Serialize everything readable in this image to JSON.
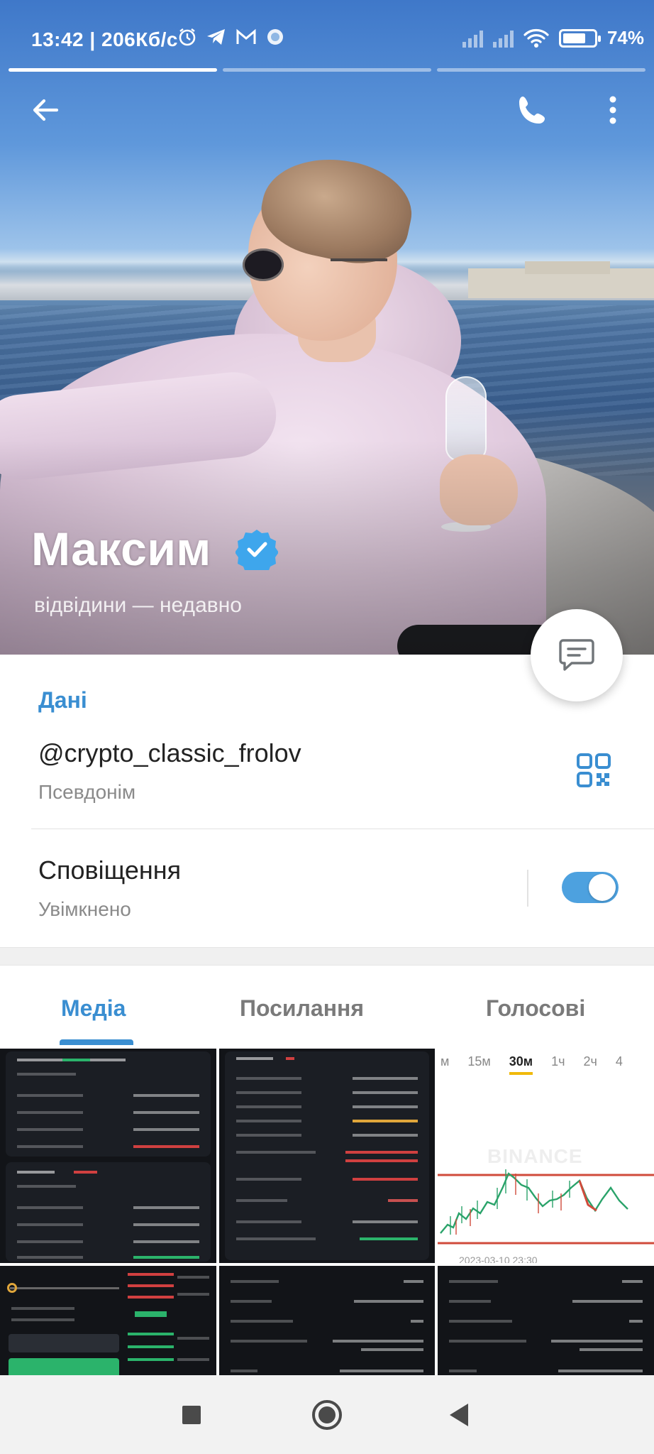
{
  "status_bar": {
    "time": "13:42 | 206Кб/с",
    "battery_percent": "74%",
    "battery_level": 0.74,
    "icons": [
      "alarm-icon",
      "telegram-icon",
      "gmail-icon",
      "sync-icon",
      "signal-icon",
      "signal-icon",
      "wifi-icon",
      "battery-icon"
    ]
  },
  "stories": {
    "count": 3,
    "active_index": 0
  },
  "header": {
    "back_icon": "arrow-left-icon",
    "call_icon": "phone-icon",
    "menu_icon": "more-vertical-icon"
  },
  "profile": {
    "name": "Максим",
    "verified": true,
    "last_seen": "відвідини — недавно",
    "message_button_icon": "message-icon"
  },
  "info": {
    "section_title": "Дані",
    "username": "@crypto_classic_frolov",
    "username_caption": "Псевдонім",
    "qr_icon": "qr-code-icon",
    "notifications_label": "Сповіщення",
    "notifications_status": "Увімкнено",
    "notifications_enabled": true
  },
  "tabs": {
    "items": [
      {
        "label": "Медіа",
        "active": true
      },
      {
        "label": "Посилання",
        "active": false
      },
      {
        "label": "Голосові",
        "active": false
      }
    ]
  },
  "media": {
    "chart_thumb": {
      "intervals": [
        "м",
        "15м",
        "30м",
        "1ч",
        "2ч",
        "4"
      ],
      "active_interval": "30м",
      "watermark": "BINANCE",
      "date": "2023-03-10 23:30"
    }
  },
  "colors": {
    "accent": "#3a8ed1",
    "toggle_on": "#4da1df",
    "text_primary": "#222222",
    "text_secondary": "#8a8a8a"
  },
  "nav_bar": {
    "icons": [
      "recents-square-icon",
      "home-circle-icon",
      "back-triangle-icon"
    ]
  }
}
